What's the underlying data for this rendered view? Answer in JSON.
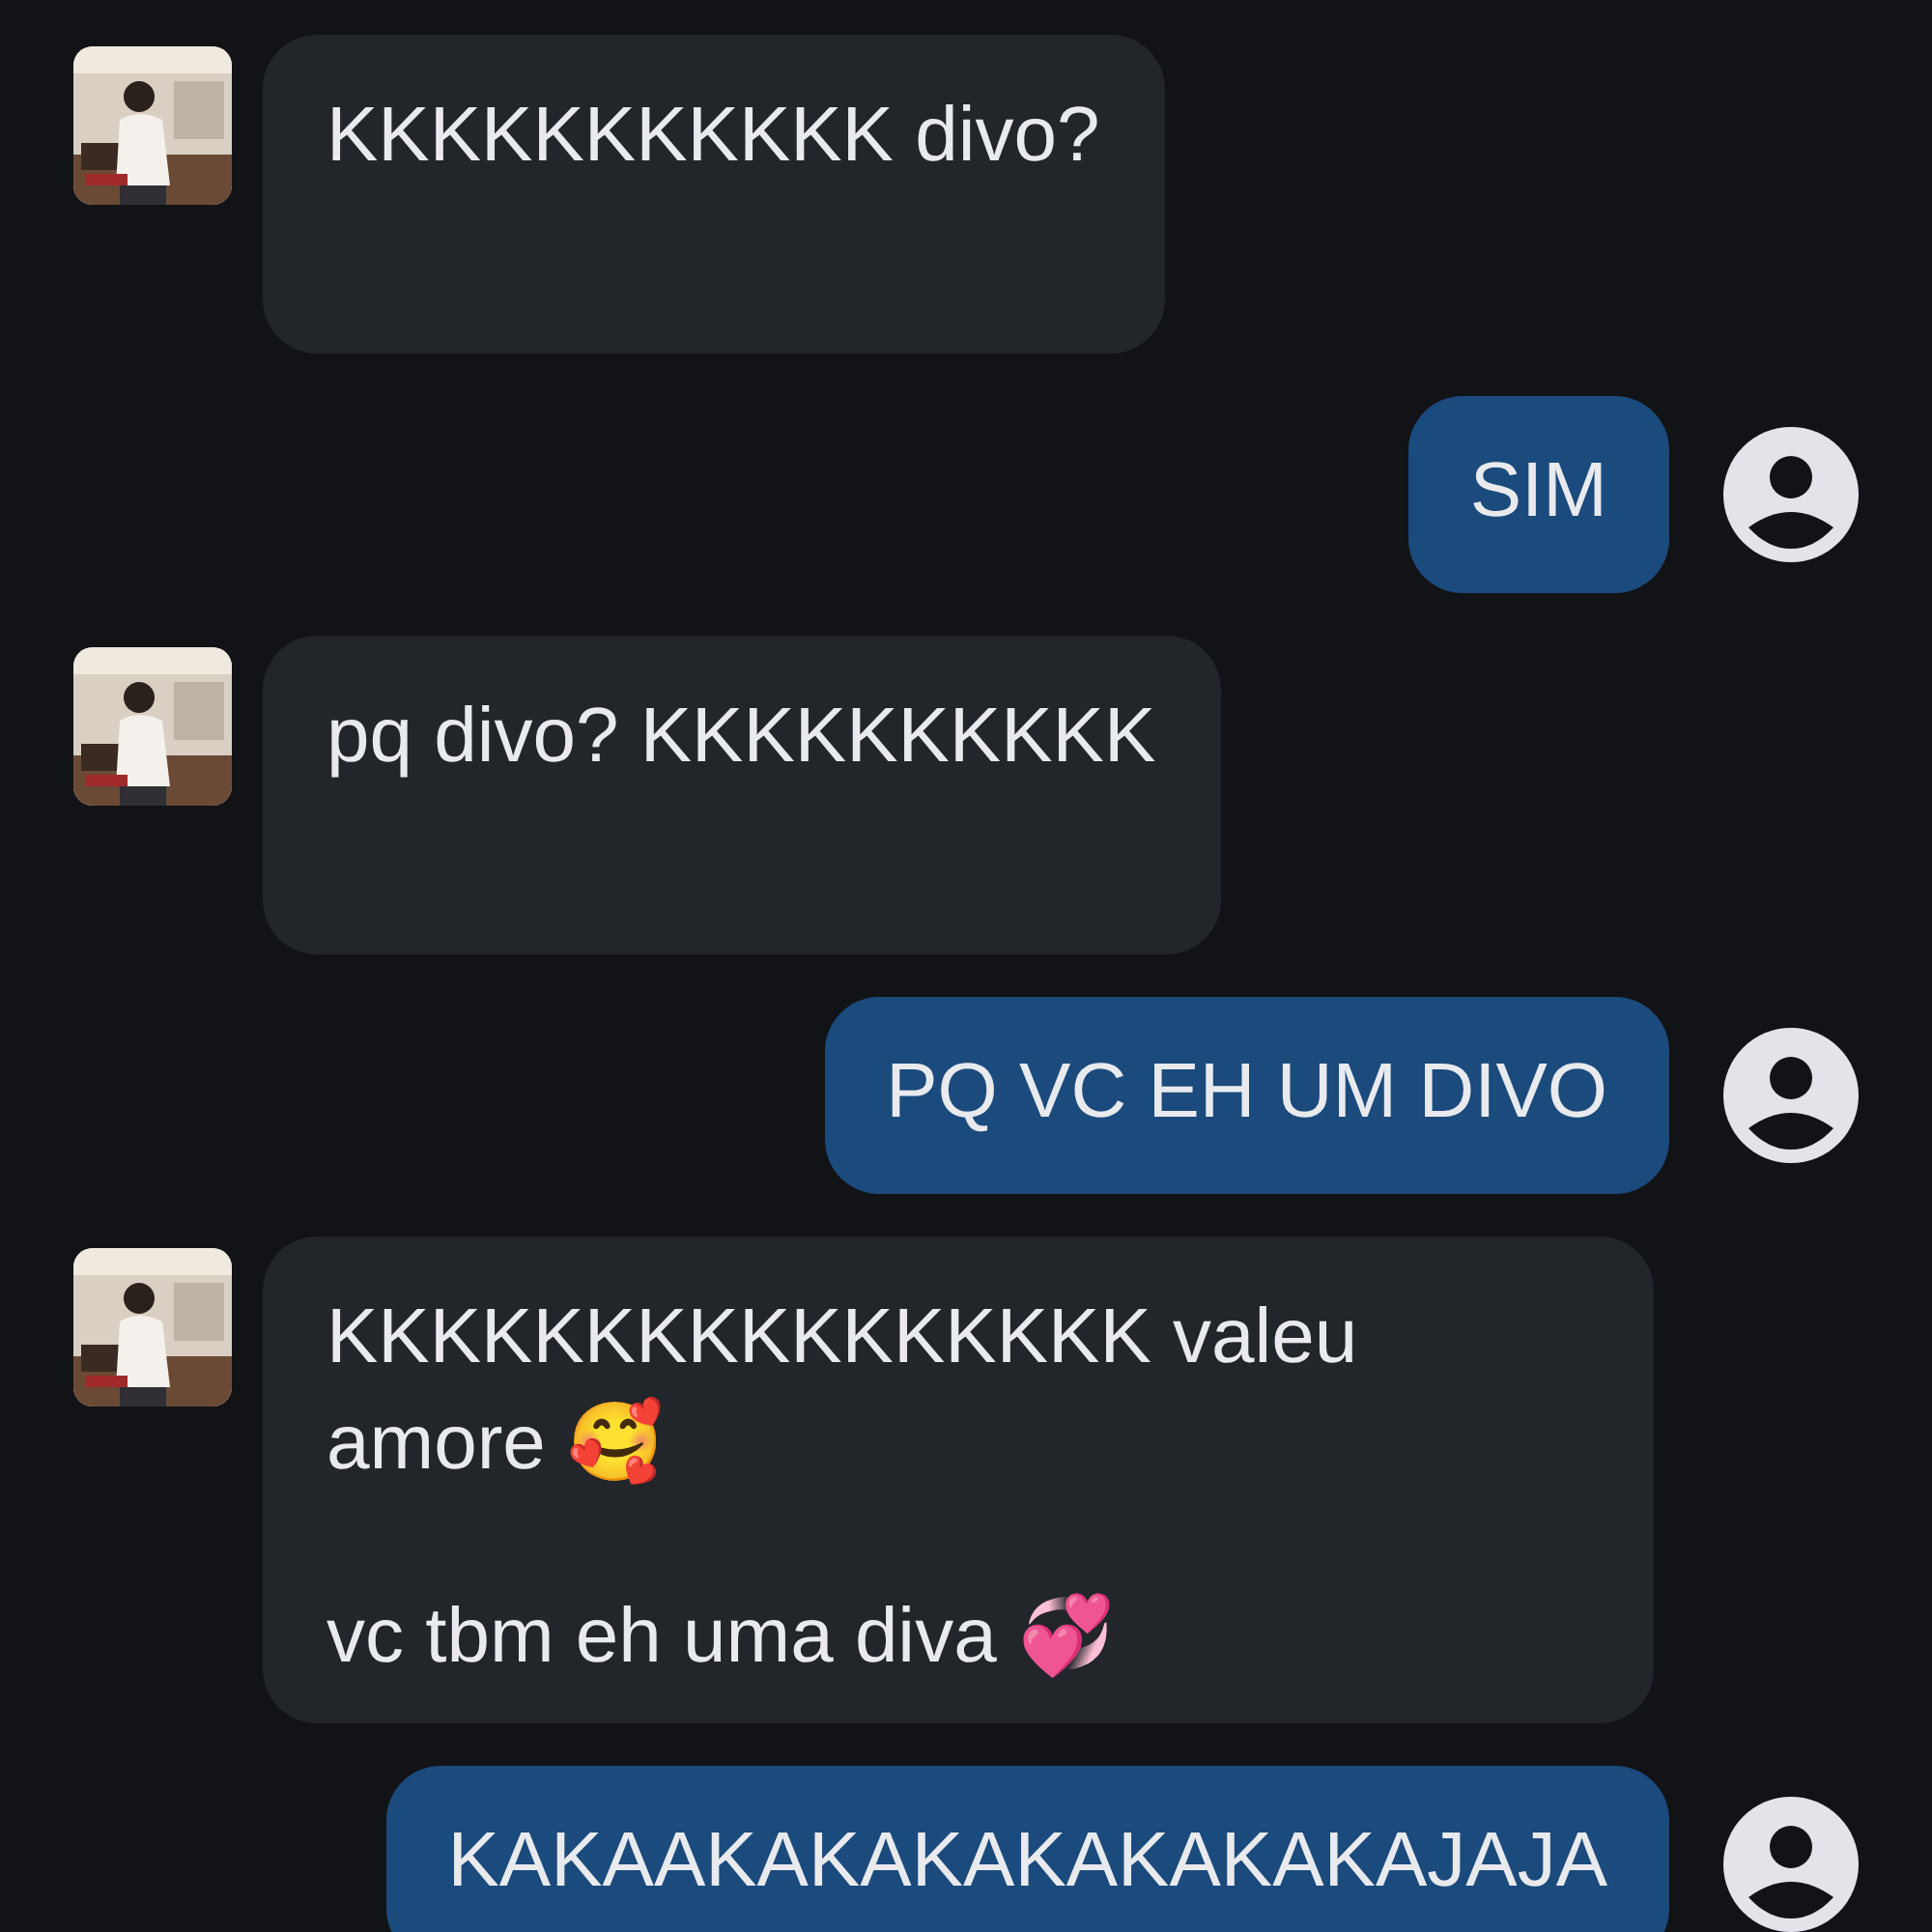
{
  "messages": [
    {
      "kind": "incoming",
      "paragraphs": [
        "KKKKKKKKKKK divo?"
      ]
    },
    {
      "kind": "outgoing",
      "paragraphs": [
        "SIM"
      ]
    },
    {
      "kind": "incoming",
      "paragraphs": [
        "pq divo? KKKKKKKKKK"
      ]
    },
    {
      "kind": "outgoing",
      "paragraphs": [
        "PQ VC EH UM DIVO"
      ]
    },
    {
      "kind": "incoming",
      "paragraphs": [
        "KKKKKKKKKKKKKKKK valeu amore 🥰",
        "vc tbm eh uma diva 💞"
      ]
    },
    {
      "kind": "outgoing",
      "paragraphs": [
        "KAKAAKAKAKAKAKAKAKAJAJA"
      ]
    }
  ]
}
